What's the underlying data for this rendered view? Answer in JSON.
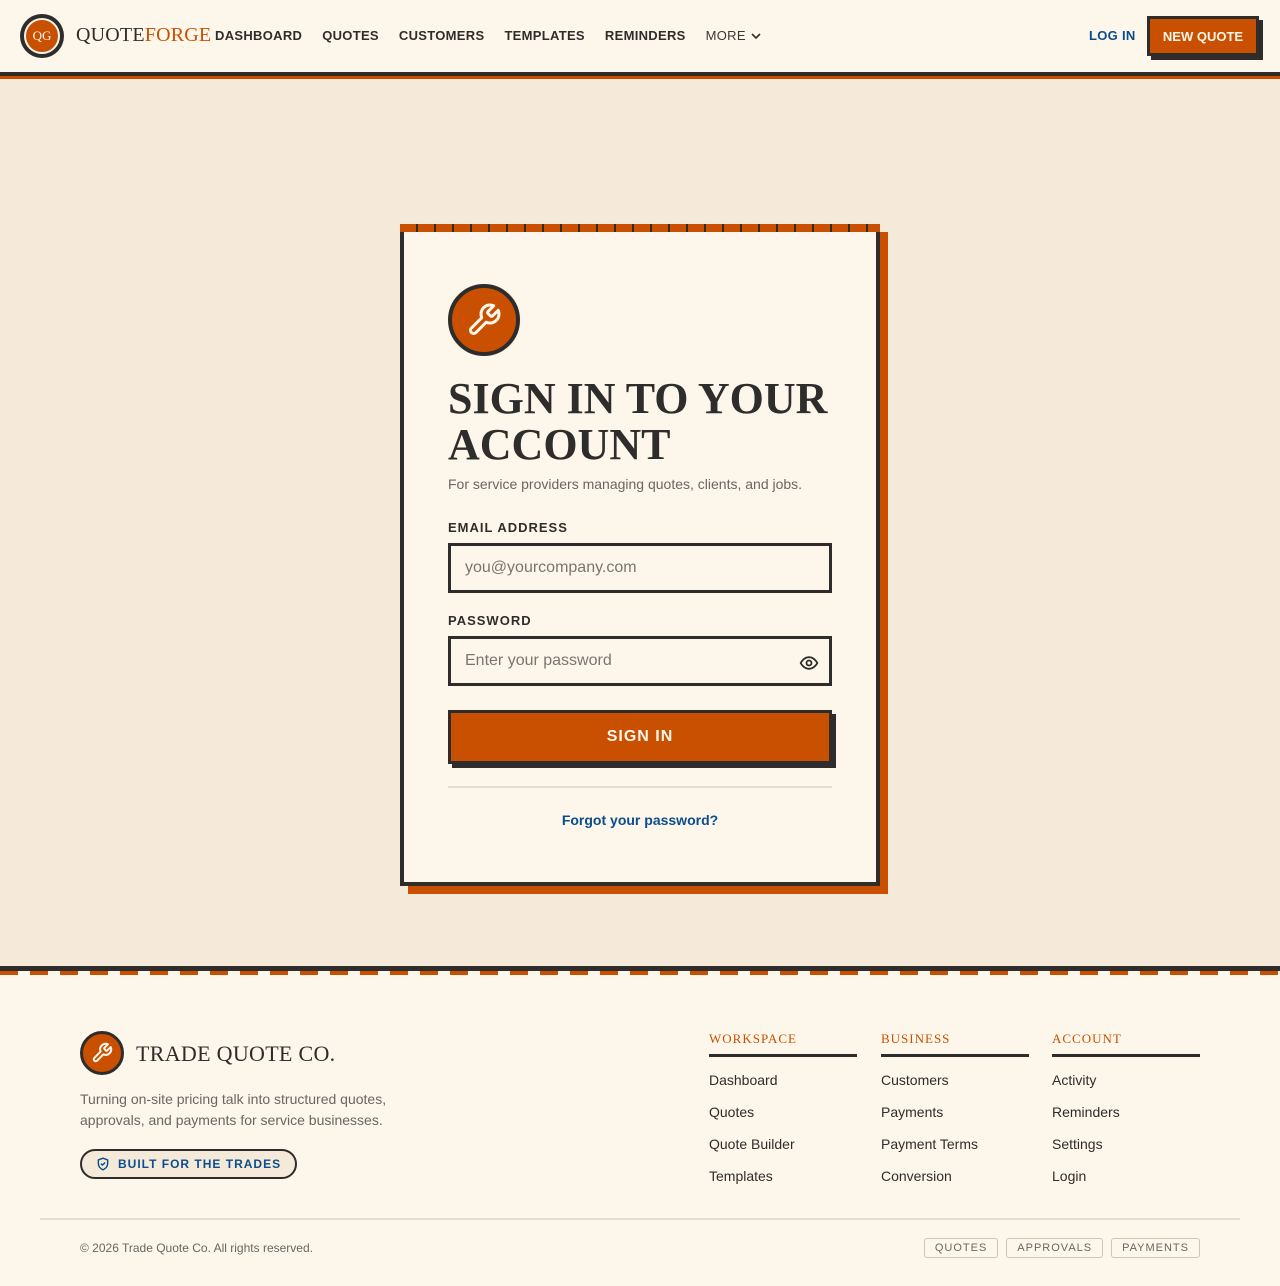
{
  "header": {
    "logo_initials": "QG",
    "brand_part1": "QUOTE",
    "brand_part2": "FORGE",
    "nav": [
      "DASHBOARD",
      "QUOTES",
      "CUSTOMERS",
      "TEMPLATES",
      "REMINDERS"
    ],
    "more_label": "MORE",
    "login_label": "LOG IN",
    "new_quote_label": "NEW QUOTE"
  },
  "card": {
    "icon": "wrench-icon",
    "title": "SIGN IN TO YOUR ACCOUNT",
    "subtitle": "For service providers managing quotes, clients, and jobs.",
    "email_label": "EMAIL ADDRESS",
    "email_placeholder": "you@yourcompany.com",
    "password_label": "PASSWORD",
    "password_placeholder": "Enter your password",
    "signin_label": "SIGN IN",
    "forgot_label": "Forgot your password?"
  },
  "footer": {
    "brand": "TRADE QUOTE CO.",
    "tagline": "Turning on-site pricing talk into structured quotes, approvals, and payments for service businesses.",
    "badge": "BUILT FOR THE TRADES",
    "columns": [
      {
        "title": "WORKSPACE",
        "items": [
          "Dashboard",
          "Quotes",
          "Quote Builder",
          "Templates"
        ]
      },
      {
        "title": "BUSINESS",
        "items": [
          "Customers",
          "Payments",
          "Payment Terms",
          "Conversion"
        ]
      },
      {
        "title": "ACCOUNT",
        "items": [
          "Activity",
          "Reminders",
          "Settings",
          "Login"
        ]
      }
    ],
    "copyright": "© 2026 Trade Quote Co. All rights reserved.",
    "pills": [
      "QUOTES",
      "APPROVALS",
      "PAYMENTS"
    ]
  },
  "colors": {
    "accent": "#c85000",
    "ink": "#2f2d2b",
    "link": "#0a4d8c",
    "paper": "#fdf6ea",
    "background": "#f5ead9"
  }
}
